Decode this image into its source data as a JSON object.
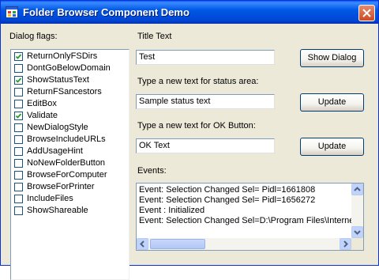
{
  "window": {
    "title": "Folder Browser Component Demo"
  },
  "flags": {
    "label": "Dialog flags:",
    "items": [
      {
        "label": "ReturnOnlyFSDirs",
        "checked": true
      },
      {
        "label": "DontGoBelowDomain",
        "checked": false
      },
      {
        "label": "ShowStatusText",
        "checked": true
      },
      {
        "label": "ReturnFSancestors",
        "checked": false
      },
      {
        "label": "EditBox",
        "checked": false
      },
      {
        "label": "Validate",
        "checked": true
      },
      {
        "label": "NewDialogStyle",
        "checked": false
      },
      {
        "label": "BrowseIncludeURLs",
        "checked": false
      },
      {
        "label": "AddUsageHint",
        "checked": false
      },
      {
        "label": "NoNewFolderButton",
        "checked": false
      },
      {
        "label": "BrowseForComputer",
        "checked": false
      },
      {
        "label": "BrowseForPrinter",
        "checked": false
      },
      {
        "label": "IncludeFiles",
        "checked": false
      },
      {
        "label": "ShowShareable",
        "checked": false
      }
    ]
  },
  "title_text": {
    "label": "Title Text",
    "value": "Test",
    "button": "Show Dialog"
  },
  "status_text": {
    "label": "Type a new text for status area:",
    "value": "Sample status text",
    "button": "Update"
  },
  "ok_text": {
    "label": "Type a new text for OK Button:",
    "value": "OK Text",
    "button": "Update"
  },
  "events": {
    "label": "Events:",
    "lines": [
      "Event: Selection Changed Sel= Pidl=1661808",
      "Event: Selection Changed Sel= Pidl=1656272",
      "Event : Initialized",
      "Event: Selection Changed Sel=D:\\Program Files\\Interne"
    ]
  },
  "colors": {
    "titlebar": "#0058e6",
    "close": "#cc4a23",
    "face": "#ece9d8"
  }
}
